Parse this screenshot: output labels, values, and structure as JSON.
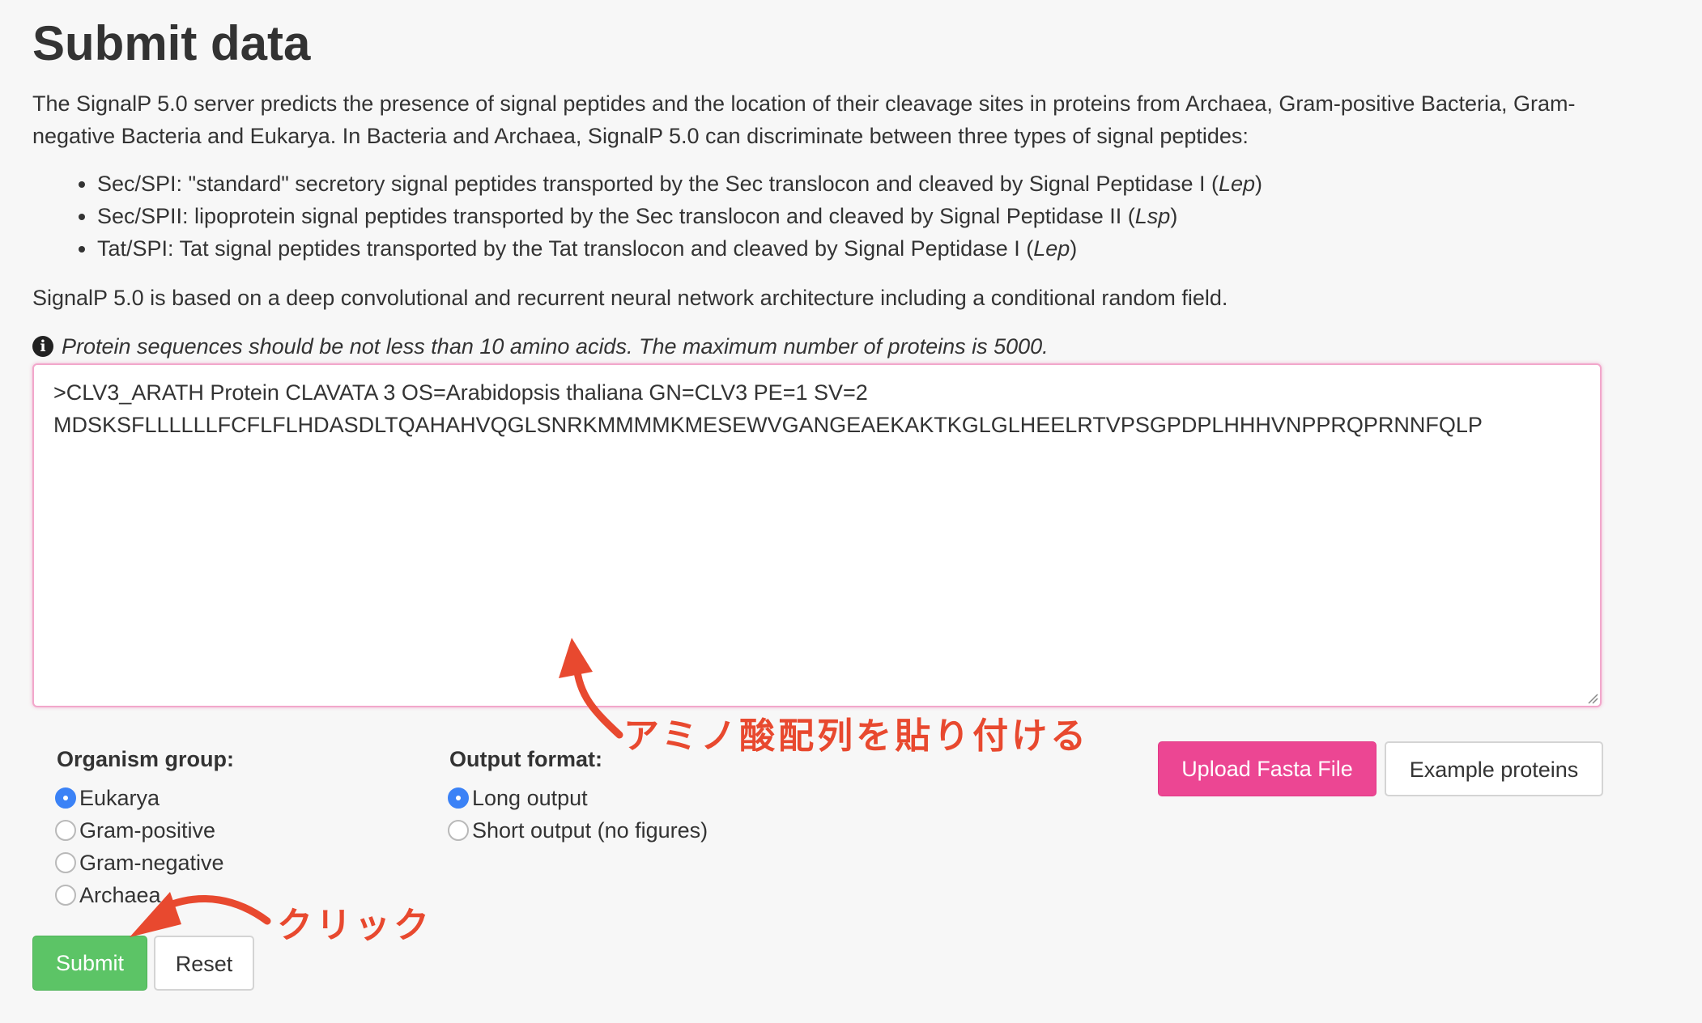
{
  "page": {
    "title": "Submit data",
    "intro": "The SignalP 5.0 server predicts the presence of signal peptides and the location of their cleavage sites in proteins from Archaea, Gram-positive Bacteria, Gram-negative Bacteria and Eukarya. In Bacteria and Archaea, SignalP 5.0 can discriminate between three types of signal peptides:",
    "types": [
      {
        "text": "Sec/SPI: \"standard\" secretory signal peptides transported by the Sec translocon and cleaved by Signal Peptidase I (",
        "enzyme": "Lep",
        "close": ")"
      },
      {
        "text": "Sec/SPII: lipoprotein signal peptides transported by the Sec translocon and cleaved by Signal Peptidase II (",
        "enzyme": "Lsp",
        "close": ")"
      },
      {
        "text": "Tat/SPI: Tat signal peptides transported by the Tat translocon and cleaved by Signal Peptidase I (",
        "enzyme": "Lep",
        "close": ")"
      }
    ],
    "architecture": "SignalP 5.0 is based on a deep convolutional and recurrent neural network architecture including a conditional random field.",
    "hint": "Protein sequences should be not less than 10 amino acids. The maximum number of proteins is 5000.",
    "hint_icon": "info-circle-icon"
  },
  "sequence": {
    "value": ">CLV3_ARATH Protein CLAVATA 3 OS=Arabidopsis thaliana GN=CLV3 PE=1 SV=2\nMDSKSFLLLLLLFCFLFLHDASDLTQAHAHVQGLSNRKMMMMKMESEWVGANGEAEKAKTKGLGLHEELRTVPSGPDPLHHHVNPPRQPRNNFQLP"
  },
  "organism": {
    "label": "Organism group:",
    "options": [
      "Eukarya",
      "Gram-positive",
      "Gram-negative",
      "Archaea"
    ],
    "selected": "Eukarya"
  },
  "output": {
    "label": "Output format:",
    "options": [
      "Long output",
      "Short output (no figures)"
    ],
    "selected": "Long output"
  },
  "buttons": {
    "upload": "Upload Fasta File",
    "example": "Example proteins",
    "submit": "Submit",
    "reset": "Reset"
  },
  "annotations": {
    "paste": "アミノ酸配列を貼り付ける",
    "click": "クリック",
    "color": "#e8492f"
  },
  "colors": {
    "upload_button": "#ec4693",
    "submit_button": "#5cc466",
    "radio_selected": "#3b82f6",
    "textarea_focus_border": "#f2a7cb"
  }
}
